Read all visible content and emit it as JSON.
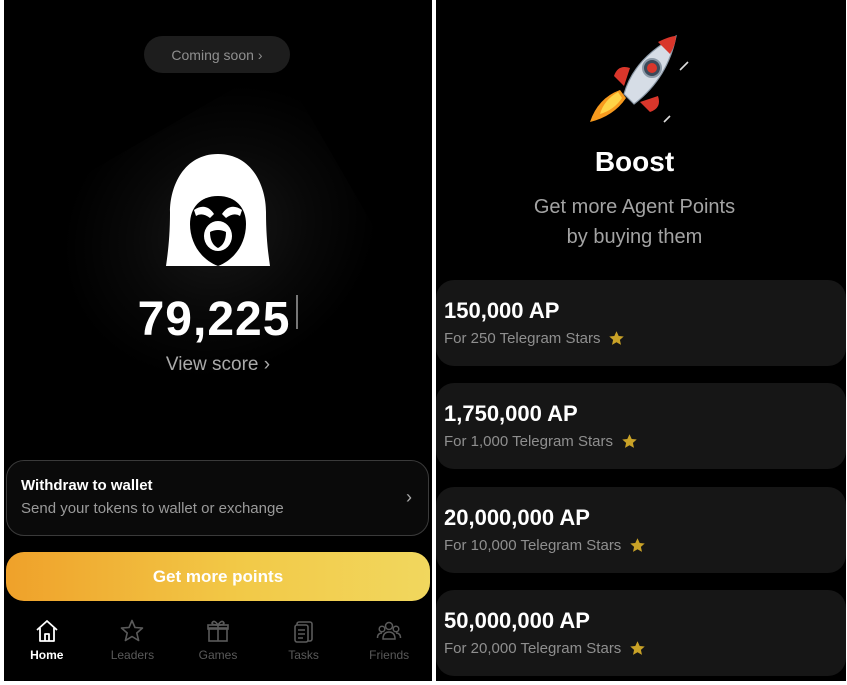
{
  "home": {
    "coming_soon": "Coming soon",
    "score": "79,225",
    "view_score": "View score",
    "withdraw": {
      "title": "Withdraw to wallet",
      "subtitle": "Send your tokens to wallet or exchange"
    },
    "cta": "Get more points",
    "cta_colors": [
      "#efa12a",
      "#f1d75e"
    ],
    "nav": [
      {
        "label": "Home",
        "icon": "home-icon",
        "active": true
      },
      {
        "label": "Leaders",
        "icon": "star-icon",
        "active": false
      },
      {
        "label": "Games",
        "icon": "gift-icon",
        "active": false
      },
      {
        "label": "Tasks",
        "icon": "clipboard-icon",
        "active": false
      },
      {
        "label": "Friends",
        "icon": "users-icon",
        "active": false
      }
    ]
  },
  "boost": {
    "title": "Boost",
    "subtitle_line1": "Get more Agent Points",
    "subtitle_line2": "by buying them",
    "offers": [
      {
        "amount": "150,000 AP",
        "price": "For 250 Telegram Stars"
      },
      {
        "amount": "1,750,000 AP",
        "price": "For 1,000 Telegram Stars"
      },
      {
        "amount": "20,000,000 AP",
        "price": "For 10,000 Telegram Stars"
      },
      {
        "amount": "50,000,000 AP",
        "price": "For 20,000 Telegram Stars"
      }
    ],
    "star_color": "#c9a227"
  }
}
